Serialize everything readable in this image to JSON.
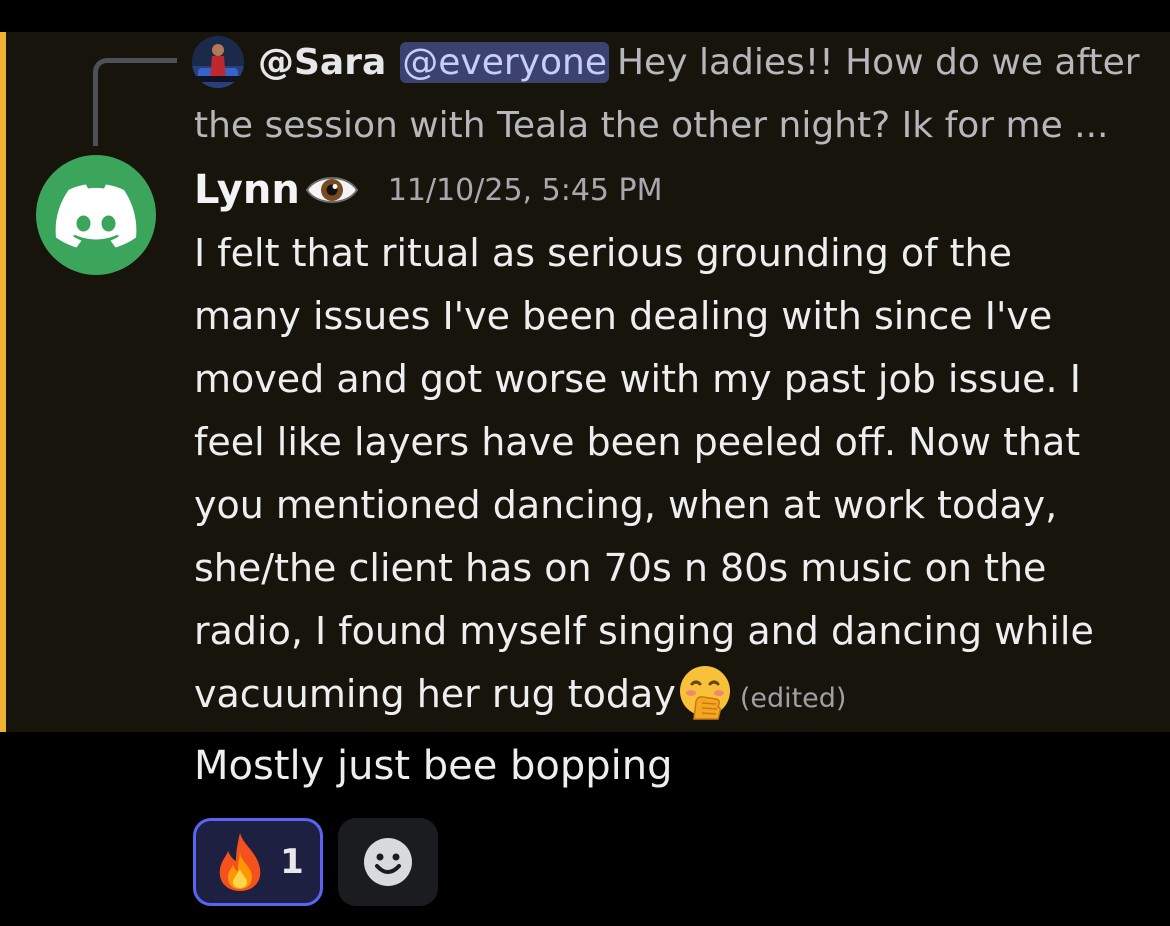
{
  "reply": {
    "author": "@Sara",
    "mention": "@everyone",
    "line1": "Hey ladies!!  How do we after",
    "line2": "the session with Teala the other night?  Ik for me ..."
  },
  "message": {
    "author": "Lynn",
    "timestamp": "11/10/25, 5:45 PM",
    "lines": [
      "I felt that ritual as serious grounding of the",
      "many issues I've been dealing with since I've",
      "moved and got worse with my past job issue. I",
      "feel like layers have been peeled off. Now that",
      "you mentioned dancing, when at work today,",
      "she/the client has on 70s n 80s music on the",
      "radio, I found myself singing and dancing while",
      "vacuuming her rug today"
    ],
    "edited_label": "(edited)"
  },
  "followup": {
    "text": "Mostly just bee bopping"
  },
  "reaction": {
    "emoji": "fire-icon",
    "count": "1"
  },
  "add_reaction": {
    "icon": "smiley-icon"
  },
  "colors": {
    "highlight_bg": "#17140b",
    "highlight_bar": "#f0b232",
    "avatar_green": "#3ba55c",
    "mention_bg": "#3c4270",
    "reaction_border": "#5865f2"
  }
}
